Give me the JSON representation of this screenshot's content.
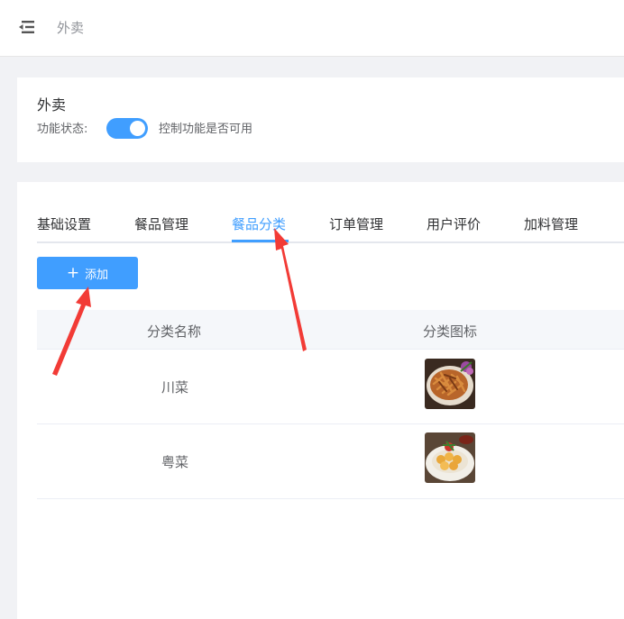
{
  "header": {
    "title": "外卖"
  },
  "module": {
    "title": "外卖",
    "status_label": "功能状态:",
    "status_enabled": true,
    "status_description": "控制功能是否可用"
  },
  "tabs": [
    {
      "label": "基础设置",
      "active": false
    },
    {
      "label": "餐品管理",
      "active": false
    },
    {
      "label": "餐品分类",
      "active": true
    },
    {
      "label": "订单管理",
      "active": false
    },
    {
      "label": "用户评价",
      "active": false
    },
    {
      "label": "加料管理",
      "active": false
    }
  ],
  "toolbar": {
    "add_label": "添加"
  },
  "table": {
    "columns": [
      "分类名称",
      "分类图标"
    ],
    "rows": [
      {
        "name": "川菜",
        "icon": "fried-food-thumbnail"
      },
      {
        "name": "粤菜",
        "icon": "dumpling-plate-thumbnail"
      }
    ]
  },
  "colors": {
    "accent": "#409eff",
    "annotation_arrow": "#f23b36"
  }
}
